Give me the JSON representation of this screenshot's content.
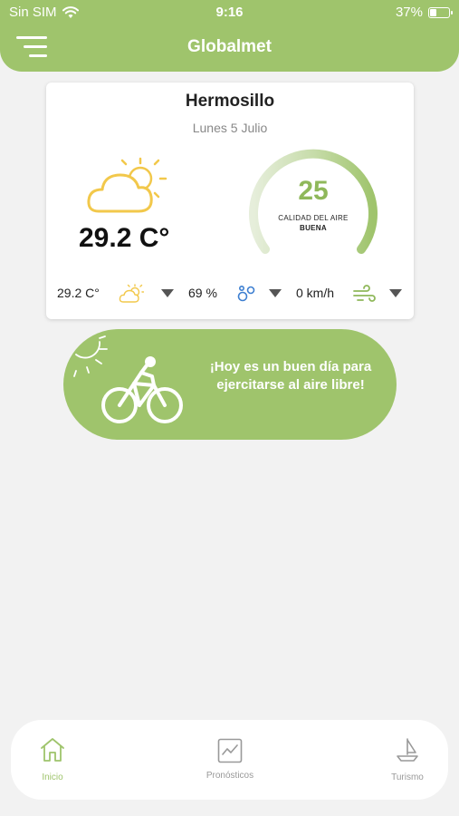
{
  "status_bar": {
    "carrier": "Sin SIM",
    "time": "9:16",
    "battery": "37%",
    "battery_level": 0.37
  },
  "header": {
    "title": "Globalmet",
    "menu_icon": "hamburger-menu-icon",
    "color": "#9fc46c"
  },
  "weather": {
    "city": "Hermosillo",
    "date": "Lunes 5 Julio",
    "temperature": "29.2 C°",
    "icon": "partly-sunny-icon"
  },
  "air_quality": {
    "value": "25",
    "label": "CALIDAD DEL AIRE",
    "status": "BUENA",
    "accent_color": "#9fc46c"
  },
  "metrics": {
    "temperature": "29.2 C°",
    "humidity": "69 %",
    "wind": "0 km/h"
  },
  "banner": {
    "message": "¡Hoy es un buen día para ejercitarse al aire libre!",
    "icon": "cyclist-icon"
  },
  "bottom_nav": {
    "items": [
      {
        "label": "Inicio",
        "icon": "home-icon",
        "active": true
      },
      {
        "label": "Pronósticos",
        "icon": "chart-icon",
        "active": false
      },
      {
        "label": "Turismo",
        "icon": "sailboat-icon",
        "active": false
      }
    ],
    "active_color": "#9fc46c",
    "inactive_color": "#999999"
  }
}
